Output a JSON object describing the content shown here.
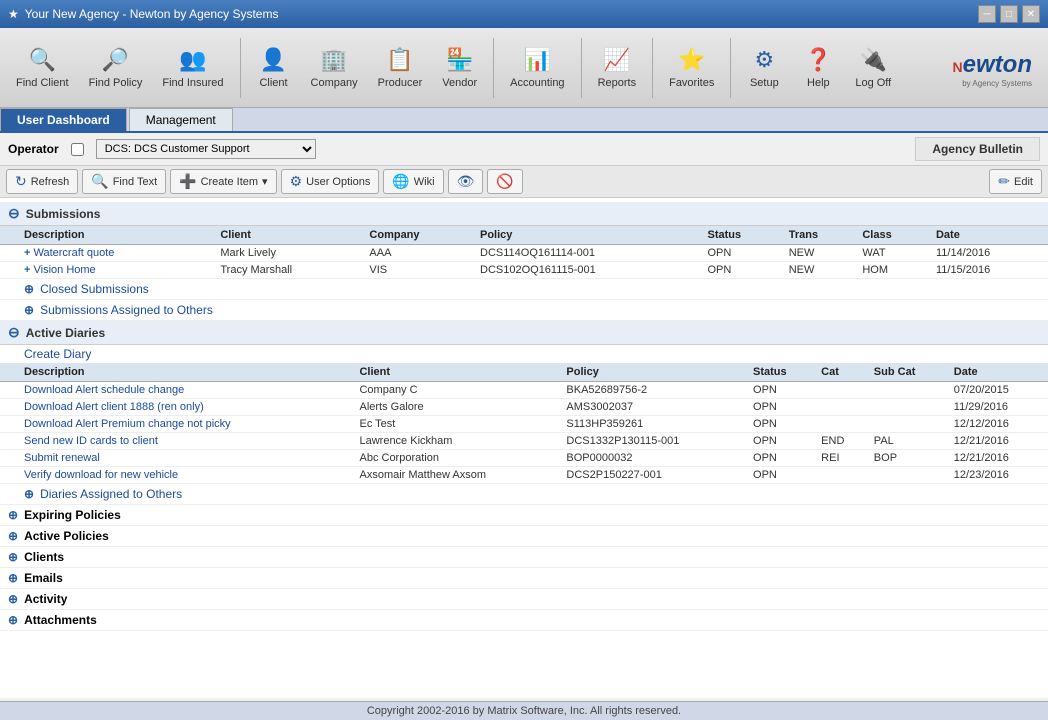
{
  "titleBar": {
    "title": "Your New Agency - Newton by Agency Systems",
    "icon": "★"
  },
  "toolbar": {
    "items": [
      {
        "id": "find-client",
        "label": "Find Client",
        "icon": "🔍"
      },
      {
        "id": "find-policy",
        "label": "Find Policy",
        "icon": "🔎"
      },
      {
        "id": "find-insured",
        "label": "Find Insured",
        "icon": "👥"
      },
      {
        "id": "client",
        "label": "Client",
        "icon": "👤"
      },
      {
        "id": "company",
        "label": "Company",
        "icon": "🏢"
      },
      {
        "id": "producer",
        "label": "Producer",
        "icon": "📋"
      },
      {
        "id": "vendor",
        "label": "Vendor",
        "icon": "🏪"
      },
      {
        "id": "accounting",
        "label": "Accounting",
        "icon": "📊"
      },
      {
        "id": "reports",
        "label": "Reports",
        "icon": "⭐"
      },
      {
        "id": "favorites",
        "label": "Favorites",
        "icon": "⭐"
      },
      {
        "id": "setup",
        "label": "Setup",
        "icon": "⚙"
      },
      {
        "id": "help",
        "label": "Help",
        "icon": "❓"
      },
      {
        "id": "logoff",
        "label": "Log Off",
        "icon": "🔌"
      }
    ]
  },
  "tabs": [
    {
      "id": "user-dashboard",
      "label": "User Dashboard",
      "active": true
    },
    {
      "id": "management",
      "label": "Management",
      "active": false
    }
  ],
  "operatorBar": {
    "label": "Operator",
    "checkboxLabel": "",
    "selectValue": "DCS: DCS Customer Support",
    "agencyBulletin": "Agency Bulletin"
  },
  "actionBar": {
    "refresh": "Refresh",
    "findText": "Find Text",
    "createItem": "Create Item",
    "userOptions": "User Options",
    "wiki": "Wiki",
    "edit": "Edit"
  },
  "submissions": {
    "sectionLabel": "Submissions",
    "columns": [
      "Description",
      "Client",
      "Company",
      "Policy",
      "Status",
      "Trans",
      "Class",
      "Date"
    ],
    "rows": [
      {
        "description": "Watercraft quote",
        "client": "Mark Lively",
        "company": "AAA",
        "policy": "DCS114OQ161114-001",
        "status": "OPN",
        "trans": "NEW",
        "class": "WAT",
        "date": "11/14/2016"
      },
      {
        "description": "Vision Home",
        "client": "Tracy Marshall",
        "company": "VIS",
        "policy": "DCS102OQ161115-001",
        "status": "OPN",
        "trans": "NEW",
        "class": "HOM",
        "date": "11/15/2016"
      }
    ],
    "closedSubmissions": "Closed Submissions",
    "submissionsAssigned": "Submissions Assigned to Others"
  },
  "activeDiaries": {
    "sectionLabel": "Active Diaries",
    "createDiary": "Create Diary",
    "columns": [
      "Description",
      "Client",
      "Policy",
      "Status",
      "Cat",
      "Sub Cat",
      "Date"
    ],
    "rows": [
      {
        "description": "Download Alert schedule change",
        "client": "Company C",
        "policy": "BKA52689756-2",
        "status": "OPN",
        "cat": "",
        "subcat": "",
        "date": "07/20/2015"
      },
      {
        "description": "Download Alert client 1888 (ren only)",
        "client": "Alerts Galore",
        "policy": "AMS3002037",
        "status": "OPN",
        "cat": "",
        "subcat": "",
        "date": "11/29/2016"
      },
      {
        "description": "Download Alert Premium change not picky",
        "client": "Ec Test",
        "policy": "S113HP359261",
        "status": "OPN",
        "cat": "",
        "subcat": "",
        "date": "12/12/2016"
      },
      {
        "description": "Send new ID cards to client",
        "client": "Lawrence Kickham",
        "policy": "DCS1332P130115-001",
        "status": "OPN",
        "cat": "END",
        "subcat": "PAL",
        "date": "12/21/2016"
      },
      {
        "description": "Submit renewal",
        "client": "Abc Corporation",
        "policy": "BOP0000032",
        "status": "OPN",
        "cat": "REI",
        "subcat": "BOP",
        "date": "12/21/2016"
      },
      {
        "description": "Verify download for new vehicle",
        "client": "Axsomair Matthew Axsom",
        "policy": "DCS2P150227-001",
        "status": "OPN",
        "cat": "",
        "subcat": "",
        "date": "12/23/2016"
      }
    ],
    "diariesAssigned": "Diaries Assigned to Others"
  },
  "collapsedSections": [
    {
      "id": "expiring-policies",
      "label": "Expiring Policies"
    },
    {
      "id": "active-policies",
      "label": "Active Policies"
    },
    {
      "id": "clients",
      "label": "Clients"
    },
    {
      "id": "emails",
      "label": "Emails"
    },
    {
      "id": "activity",
      "label": "Activity"
    },
    {
      "id": "attachments",
      "label": "Attachments"
    }
  ],
  "footer": {
    "copyright": "Copyright 2002-2016 by Matrix Software, Inc. All rights reserved."
  }
}
